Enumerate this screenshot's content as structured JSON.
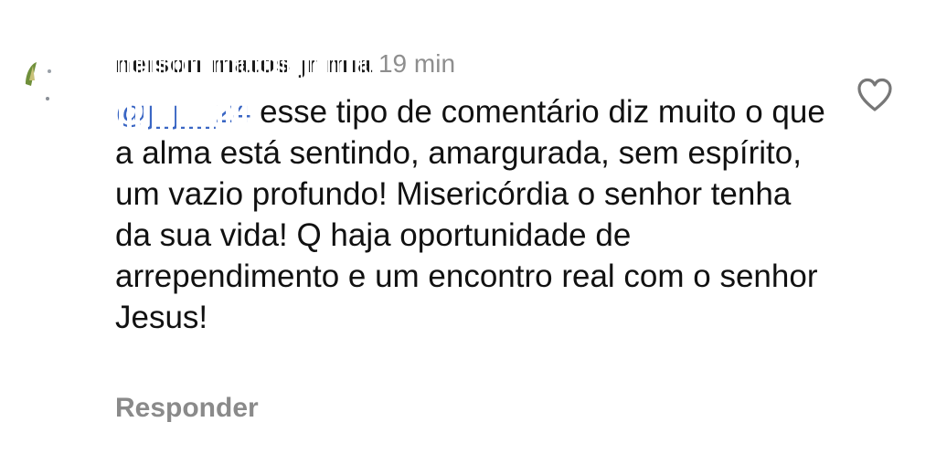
{
  "comment": {
    "author": "nelson matos jr mia",
    "time": "19 min",
    "mention": "@j_j__24",
    "text": " esse tipo de comentário diz muito o que a alma está sentindo, amargurada, sem espírito, um vazio profundo! Misericórdia o senhor tenha da sua vida! Q haja oportunidade de arrependimento e um encontro real com o senhor Jesus!",
    "reply_label": "Responder"
  },
  "icons": {
    "avatar": "avatar-icon",
    "like": "heart-outline-icon"
  },
  "colors": {
    "mention": "#3a66c4",
    "muted": "#8e8e8e",
    "text": "#111111"
  }
}
